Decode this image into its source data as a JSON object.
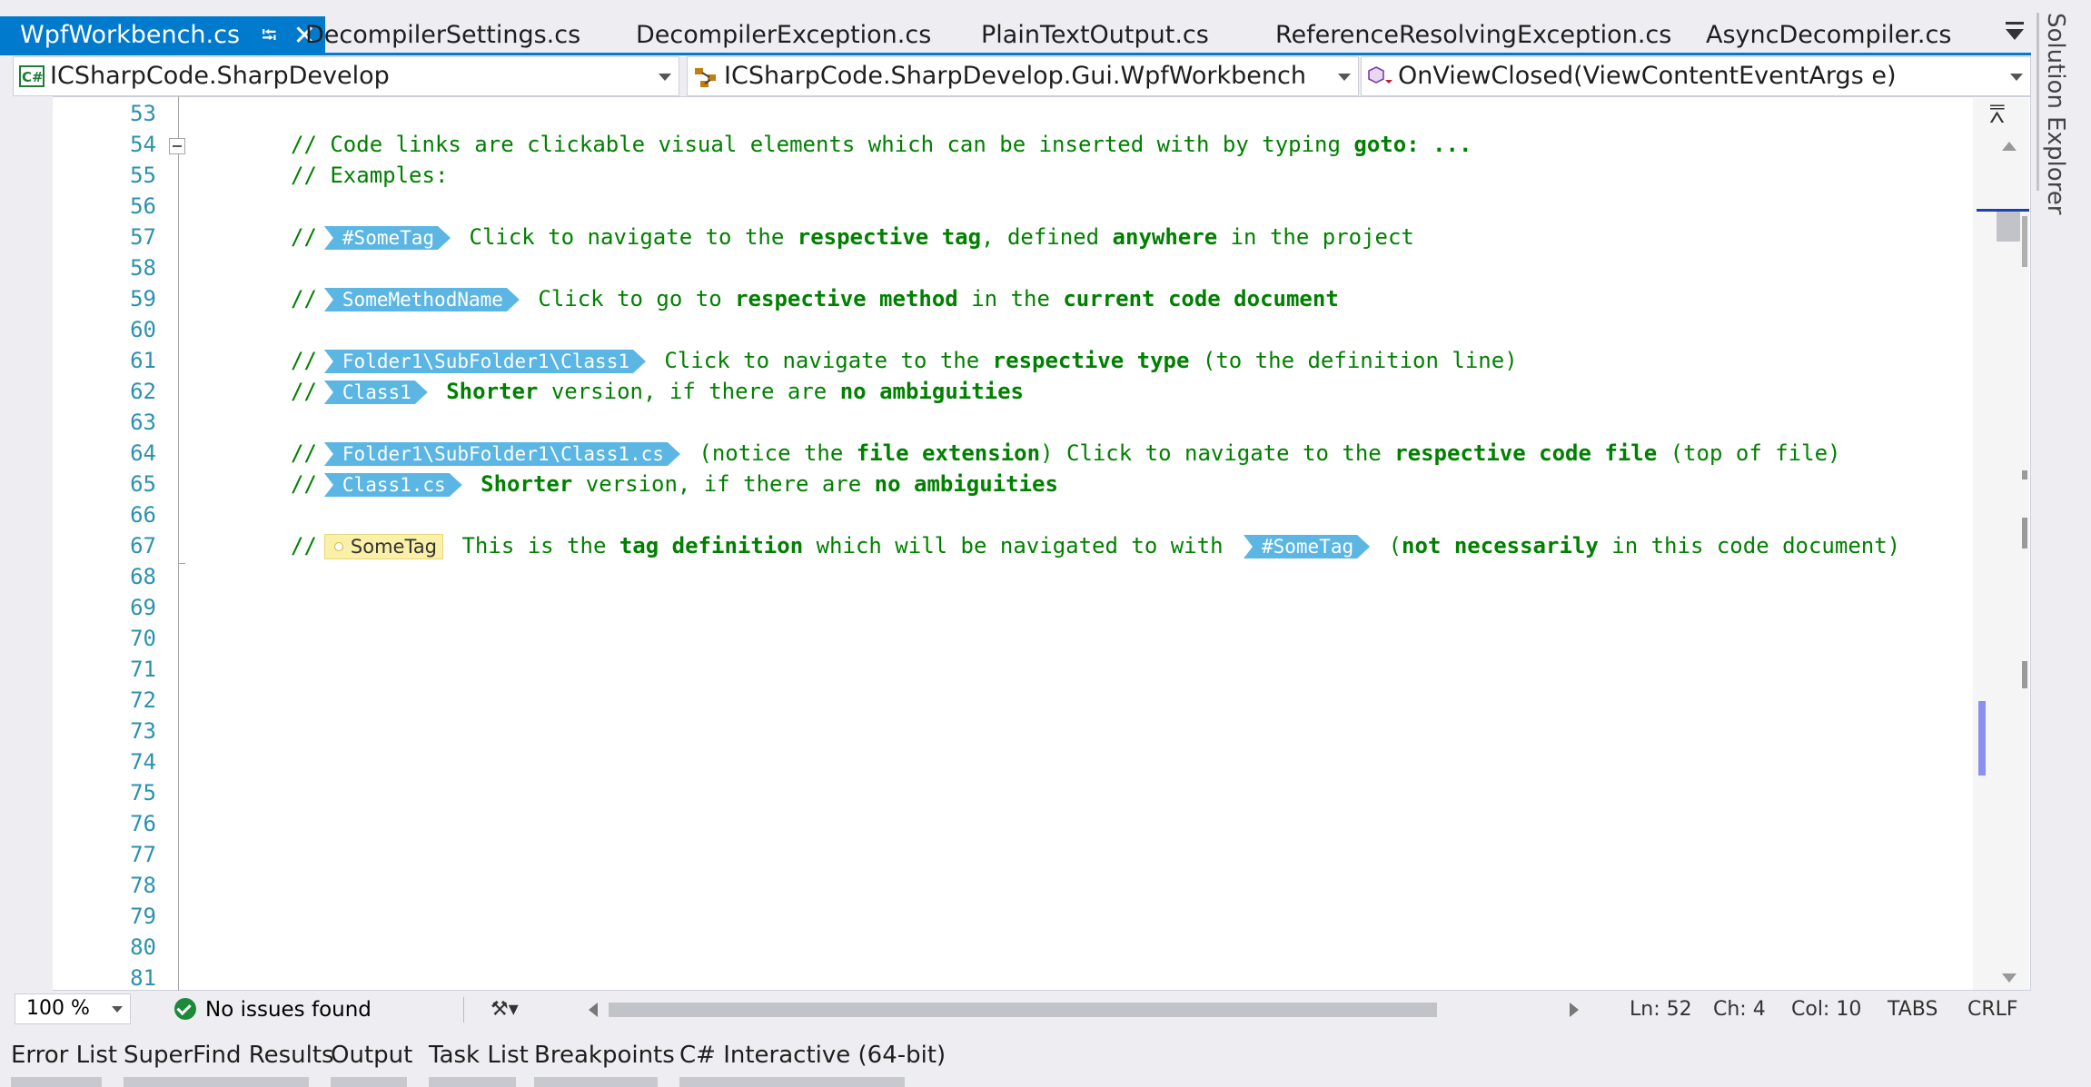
{
  "tabs": [
    {
      "label": "WpfWorkbench.cs",
      "active": true
    },
    {
      "label": "DecompilerSettings.cs"
    },
    {
      "label": "DecompilerException.cs"
    },
    {
      "label": "PlainTextOutput.cs"
    },
    {
      "label": "ReferenceResolvingException.cs"
    },
    {
      "label": "AsyncDecompiler.cs"
    }
  ],
  "navbar": {
    "project": "ICSharpCode.SharpDevelop",
    "type": "ICSharpCode.SharpDevelop.Gui.WpfWorkbench",
    "member": "OnViewClosed(ViewContentEventArgs e)"
  },
  "editor": {
    "line_numbers": [
      "53",
      "54",
      "55",
      "56",
      "57",
      "58",
      "59",
      "60",
      "61",
      "62",
      "63",
      "64",
      "65",
      "66",
      "67",
      "68",
      "69",
      "70",
      "71",
      "72",
      "73",
      "74",
      "75",
      "76",
      "77",
      "78",
      "79",
      "80",
      "81"
    ],
    "code": {
      "l54_a": "// Code links are clickable visual elements which can be inserted with by typing ",
      "l54_b": "goto: ...",
      "l55": "// Examples:",
      "comment": "//",
      "l57_tag": "#SomeTag",
      "l57_a": " Click to navigate to the ",
      "l57_b": "respective tag",
      "l57_c": ", defined ",
      "l57_d": "anywhere",
      "l57_e": " in the project",
      "l59_tag": "SomeMethodName",
      "l59_a": " Click to go to ",
      "l59_b": "respective method",
      "l59_c": " in the ",
      "l59_d": "current code document",
      "l61_tag": "Folder1\\SubFolder1\\Class1",
      "l61_a": " Click to navigate to the ",
      "l61_b": "respective type",
      "l61_c": " (to the definition line)",
      "l62_tag": "Class1",
      "l62_a": " ",
      "l62_b": "Shorter",
      "l62_c": " version, if there are ",
      "l62_d": "no ambiguities",
      "l64_tag": "Folder1\\SubFolder1\\Class1.cs",
      "l64_a": " (notice the ",
      "l64_b": "file extension",
      "l64_c": ") Click to navigate to the ",
      "l64_d": "respective code file",
      "l64_e": " (top of file)",
      "l65_tag": "Class1.cs",
      "l65_a": " ",
      "l65_b": "Shorter",
      "l65_c": " version, if there are ",
      "l65_d": "no ambiguities",
      "l67_def": "SomeTag",
      "l67_a": " This is the ",
      "l67_b": "tag definition",
      "l67_c": " which will be navigated to with ",
      "l67_tag": "#SomeTag",
      "l67_d": " (",
      "l67_e": "not necessarily",
      "l67_f": " in this code document)"
    }
  },
  "status": {
    "zoom": "100 %",
    "issues": "No issues found",
    "ln": "Ln: 52",
    "ch": "Ch: 4",
    "col": "Col: 10",
    "tabs": "TABS",
    "eol": "CRLF"
  },
  "side_panel": "Solution Explorer",
  "bottom_tabs": [
    "Error List",
    "SuperFind Results",
    "Output",
    "Task List",
    "Breakpoints",
    "C# Interactive (64-bit)"
  ],
  "colors": {
    "accent": "#007acc",
    "comment": "#008000",
    "line_number": "#2b91af",
    "code_link": "#5bb6e3",
    "tag_definition": "#fbf0a8"
  },
  "icons": [
    "pin-icon",
    "close-icon",
    "tab-overflow-icon",
    "csharp-project-icon",
    "class-icon",
    "method-icon",
    "split-window-icon",
    "check-circle-icon",
    "brush-icon"
  ]
}
